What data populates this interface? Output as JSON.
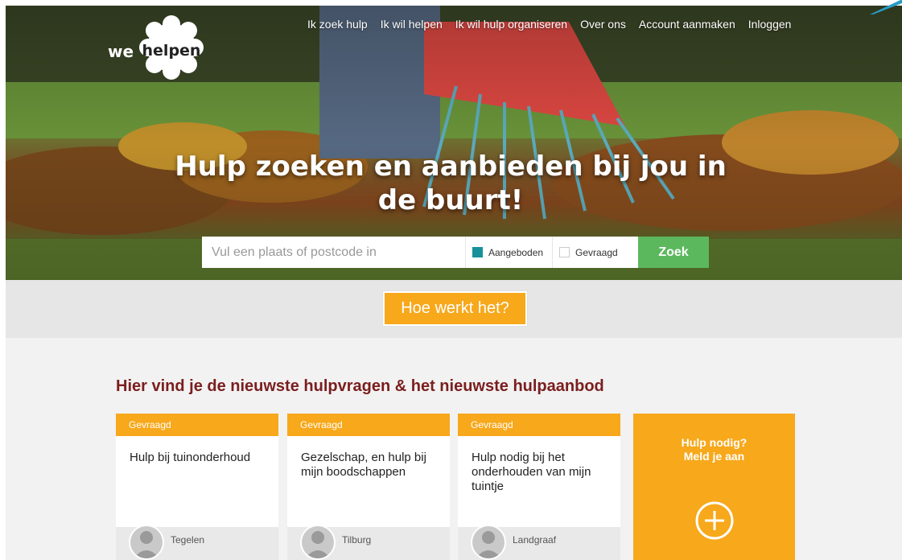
{
  "brand": {
    "prefix": "we",
    "name": "helpen"
  },
  "nav": {
    "items": [
      {
        "label": "Ik zoek hulp"
      },
      {
        "label": "Ik wil helpen"
      },
      {
        "label": "Ik wil hulp organiseren"
      },
      {
        "label": "Over ons"
      },
      {
        "label": "Account aanmaken"
      },
      {
        "label": "Inloggen"
      }
    ]
  },
  "hero": {
    "title": "Hulp zoeken en aanbieden bij jou in de buurt!"
  },
  "search": {
    "placeholder": "Vul een plaats of postcode in",
    "options": [
      {
        "label": "Aangeboden",
        "checked": true
      },
      {
        "label": "Gevraagd",
        "checked": false
      }
    ],
    "button": "Zoek"
  },
  "how": {
    "label": "Hoe werkt het?"
  },
  "section": {
    "title": "Hier vind je de nieuwste hulpvragen & het nieuwste hulpaanbod"
  },
  "cards": [
    {
      "tag": "Gevraagd",
      "title": "Hulp bij tuinonderhoud",
      "place": "Tegelen"
    },
    {
      "tag": "Gevraagd",
      "title": "Gezelschap, en hulp bij mijn boodschappen",
      "place": "Tilburg"
    },
    {
      "tag": "Gevraagd",
      "title": "Hulp nodig bij het onderhouden van mijn tuintje",
      "place": "Landgraaf"
    }
  ],
  "cta": {
    "line1": "Hulp nodig?",
    "line2": "Meld je aan",
    "icon": "plus-circle-icon"
  },
  "colors": {
    "accent": "#f7a81b",
    "button": "#5cb85c",
    "teal": "#17919a",
    "section_title": "#7a1e1e"
  }
}
